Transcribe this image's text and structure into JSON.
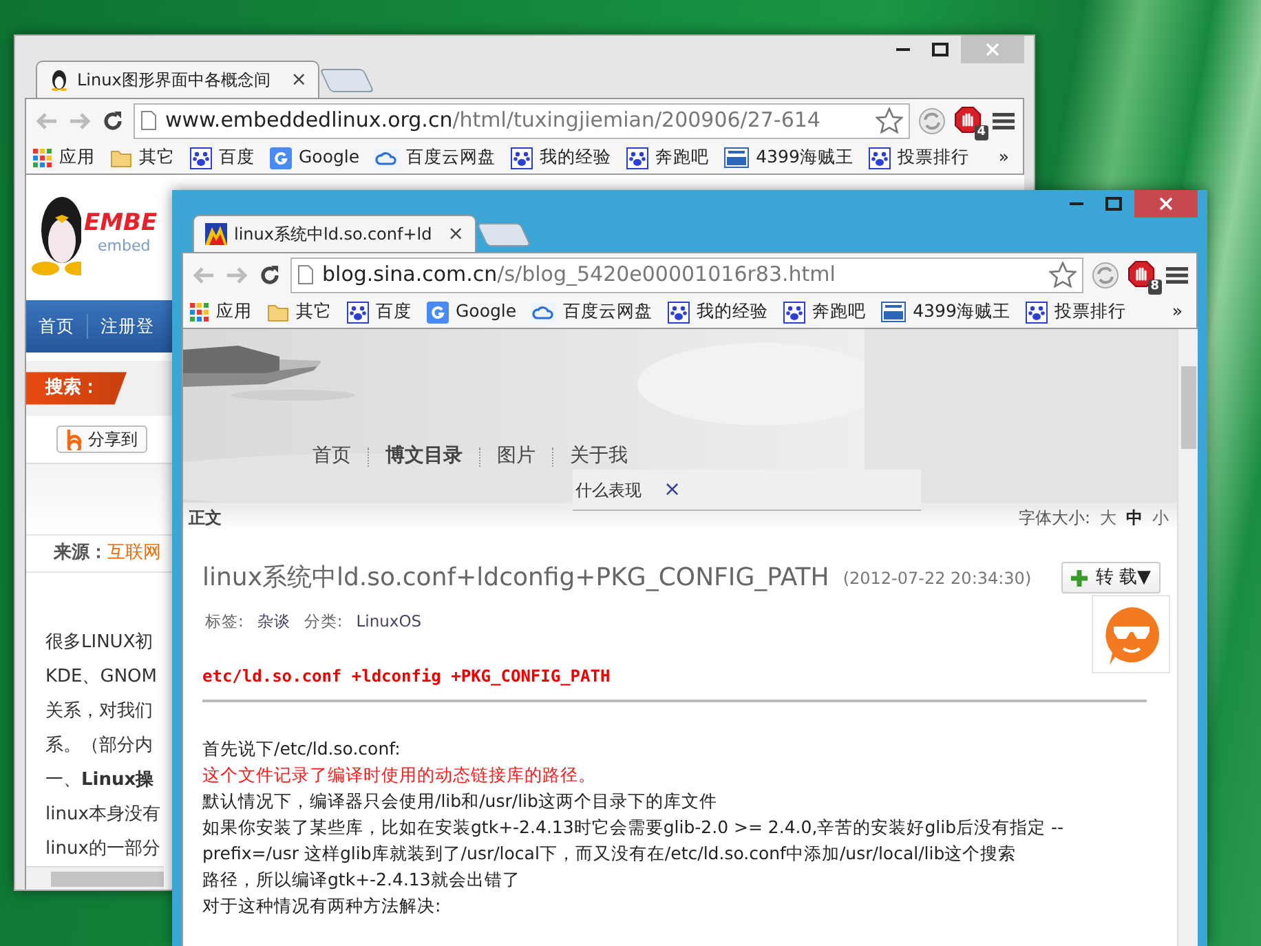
{
  "back_window": {
    "active": false,
    "tab_title": "Linux图形界面中各概念间",
    "tab_close": "×",
    "url_host": "www.embeddedlinux.org.cn",
    "url_path": "/html/tuxingjiemian/200906/27-614",
    "extension_badge": "4",
    "bookmarks": [
      {
        "label": "应用",
        "kind": "apps"
      },
      {
        "label": "其它",
        "kind": "folder"
      },
      {
        "label": "百度",
        "kind": "paw"
      },
      {
        "label": "Google",
        "kind": "google"
      },
      {
        "label": "百度云网盘",
        "kind": "cloud"
      },
      {
        "label": "我的经验",
        "kind": "paw"
      },
      {
        "label": "奔跑吧",
        "kind": "paw"
      },
      {
        "label": "4399海贼王",
        "kind": "game"
      },
      {
        "label": "投票排行",
        "kind": "paw"
      }
    ],
    "bookmarks_more": "»",
    "page": {
      "logo_text": "EMBE",
      "logo_subtext": "embed",
      "nav": [
        "首页",
        "注册登"
      ],
      "search_label": "搜索：",
      "share_label": "分享到",
      "source_label": "来源：",
      "source_value": "互联网",
      "lines": [
        "很多LINUX初",
        "KDE、GNOM",
        "关系，对我们",
        "系。（部分内",
        "一、**Linux操**",
        "linux本身没有",
        "linux的一部分"
      ]
    }
  },
  "front_window": {
    "active": true,
    "tab_title": "linux系统中ld.so.conf+ld",
    "tab_close": "×",
    "url_host": "blog.sina.com.cn",
    "url_path": "/s/blog_5420e00001016r83.html",
    "extension_badge": "8",
    "bookmarks": [
      {
        "label": "应用",
        "kind": "apps"
      },
      {
        "label": "其它",
        "kind": "folder"
      },
      {
        "label": "百度",
        "kind": "paw"
      },
      {
        "label": "Google",
        "kind": "google"
      },
      {
        "label": "百度云网盘",
        "kind": "cloud"
      },
      {
        "label": "我的经验",
        "kind": "paw"
      },
      {
        "label": "奔跑吧",
        "kind": "paw"
      },
      {
        "label": "4399海贼王",
        "kind": "game"
      },
      {
        "label": "投票排行",
        "kind": "paw"
      }
    ],
    "bookmarks_more": "»",
    "page": {
      "nav": [
        {
          "label": "首页",
          "selected": false
        },
        {
          "label": "博文目录",
          "selected": true
        },
        {
          "label": "图片",
          "selected": false
        },
        {
          "label": "关于我",
          "selected": false
        }
      ],
      "popup": {
        "text": "什么表现",
        "close": "×"
      },
      "section_label": "正文",
      "font_size_label": "字体大小:",
      "font_sizes": [
        {
          "label": "大",
          "selected": false
        },
        {
          "label": "中",
          "selected": true
        },
        {
          "label": "小",
          "selected": false
        }
      ],
      "title": "linux系统中ld.so.conf+ldconfig+PKG_CONFIG_PATH",
      "date": "(2012-07-22 20:34:30)",
      "repost_button": "转 载",
      "repost_caret": "▼",
      "tags_label": "标签:",
      "tags": "杂谈",
      "category_label": "分类:",
      "category": "LinuxOS",
      "subtitle": "etc/ld.so.conf +ldconfig +PKG_CONFIG_PATH",
      "lines": [
        {
          "text": "首先说下/etc/ld.so.conf:",
          "kind": "plain"
        },
        {
          "text": "这个文件记录了编译时使用的动态链接库的路径。",
          "kind": "emphasis"
        },
        {
          "text": "默认情况下，编译器只会使用/lib和/usr/lib这两个目录下的库文件",
          "kind": "plain"
        },
        {
          "text": "如果你安装了某些库，比如在安装gtk+-2.4.13时它会需要glib-2.0 >= 2.4.0,辛苦的安装好glib后没有指定 --",
          "kind": "plain"
        },
        {
          "text": "prefix=/usr 这样glib库就装到了/usr/local下，而又没有在/etc/ld.so.conf中添加/usr/local/lib这个搜索",
          "kind": "plain"
        },
        {
          "text": "路径，所以编译gtk+-2.4.13就会出错了",
          "kind": "plain"
        },
        {
          "text": "对于这种情况有两种方法解决:",
          "kind": "plain"
        }
      ]
    }
  }
}
